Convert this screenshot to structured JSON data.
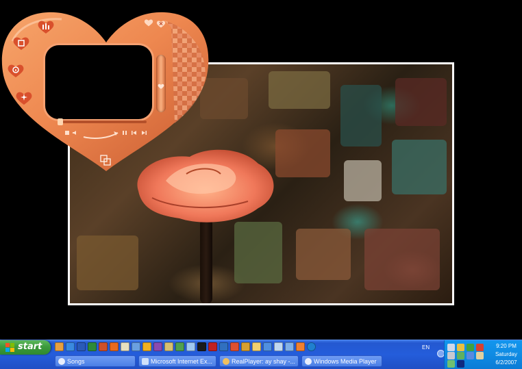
{
  "desktop": {
    "wallpaper": "rose-photo"
  },
  "player": {
    "skin": "heart",
    "accent_color": "#f08a50",
    "icons": [
      "equalizer-icon",
      "playlist-icon",
      "info-icon",
      "visualization-icon",
      "minimize-icon",
      "close-icon",
      "fullscreen-icon",
      "stop-icon",
      "pause-icon",
      "previous-icon",
      "next-icon",
      "play-icon"
    ]
  },
  "taskbar": {
    "start_label": "start",
    "quicklaunch_icons": [
      "outlook-icon",
      "internet-explorer-icon",
      "word-icon",
      "excel-icon",
      "powerpoint-icon",
      "firefox-icon",
      "paint-icon",
      "network-icon",
      "windows-update-icon",
      "media-icon",
      "chess-icon",
      "messenger-icon",
      "folder-icon",
      "realplayer-icon",
      "record-icon",
      "blue-app-icon",
      "shield-icon",
      "realone-icon",
      "explorer-icon",
      "media-player-icon",
      "tool-icon",
      "mail-icon",
      "flame-icon",
      "play-icon"
    ],
    "tasks": [
      {
        "label": "Songs",
        "icon": "folder-icon"
      },
      {
        "label": "Microsoft Internet Ex...",
        "icon": "internet-explorer-icon"
      },
      {
        "label": "RealPlayer: ay shay -...",
        "icon": "realplayer-icon"
      },
      {
        "label": "Windows Media Player",
        "icon": "media-player-icon"
      }
    ],
    "language": "EN",
    "clock": {
      "time": "9:20 PM",
      "day": "Saturday",
      "date": "6/2/2007"
    }
  }
}
